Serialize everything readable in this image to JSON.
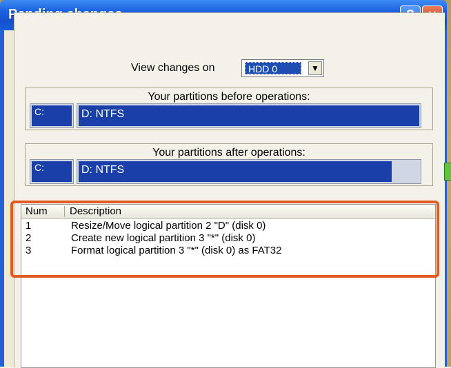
{
  "window": {
    "title": "Pending changes",
    "help_glyph": "?",
    "close_glyph": "×"
  },
  "view_changes": {
    "label": "View changes on",
    "selected_disk": "HDD 0"
  },
  "before": {
    "title": "Your partitions before operations:",
    "partitions": [
      {
        "label": "C:"
      },
      {
        "label": "D: NTFS"
      }
    ]
  },
  "after": {
    "title": "Your partitions after operations:",
    "partitions": [
      {
        "label": "C:"
      },
      {
        "label": "D: NTFS"
      },
      {
        "label": "*:"
      }
    ]
  },
  "operations": {
    "columns": [
      "Num",
      "Description"
    ],
    "rows": [
      {
        "num": "1",
        "description": "Resize/Move  logical partition 2  \"D\" (disk 0)"
      },
      {
        "num": "2",
        "description": "Create new logical partition 3  \"*\" (disk 0)"
      },
      {
        "num": "3",
        "description": "Format logical partition 3  \"*\" (disk 0)  as FAT32"
      }
    ]
  },
  "colors": {
    "title_bar": "#1b63e2",
    "partition_fill": "#1a3fa8",
    "new_partition": "#61c43a",
    "highlight_outline": "#e25a24"
  },
  "icons": {
    "help": "help-icon",
    "close": "close-icon",
    "dropdown": "chevron-down-icon"
  }
}
